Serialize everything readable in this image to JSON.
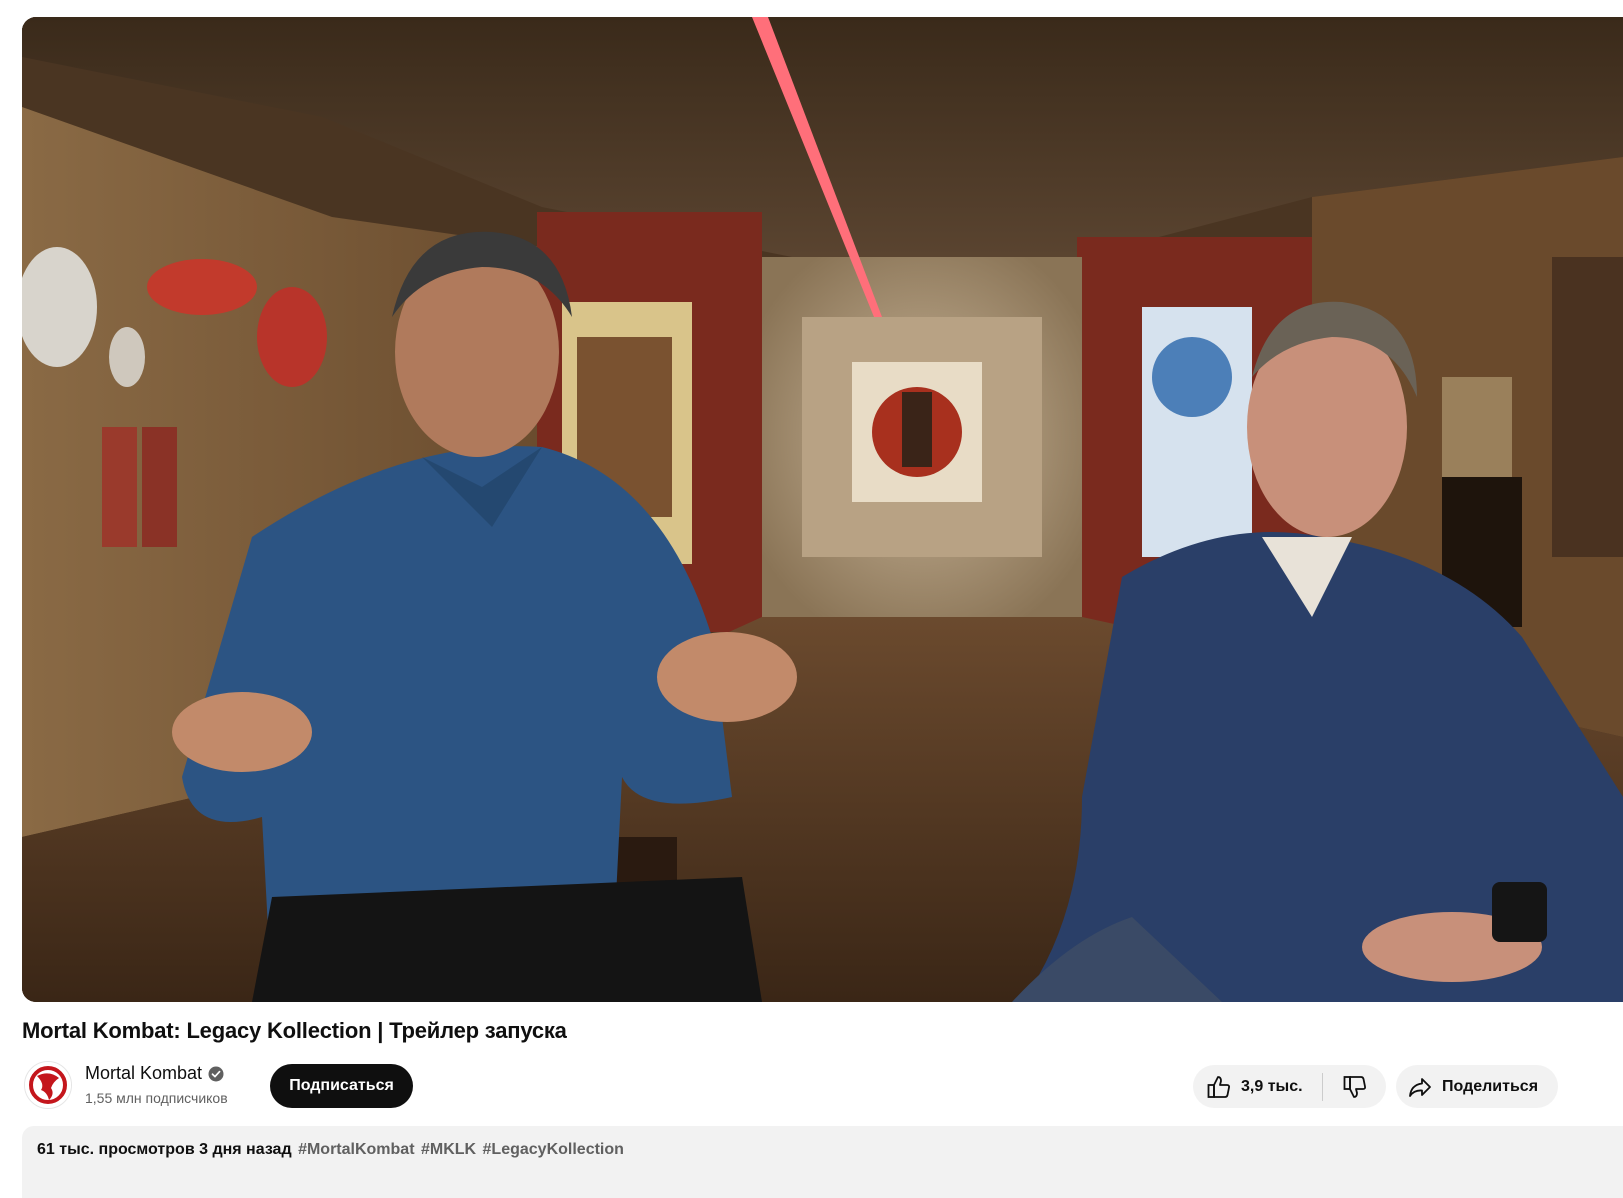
{
  "video": {
    "title": "Mortal Kombat: Legacy Kollection | Трейлер запуска",
    "frame_description_icon": "video-frame"
  },
  "channel": {
    "name": "Mortal Kombat",
    "subscribers": "1,55 млн подписчиков",
    "avatar_icon": "mortal-kombat-dragon-logo",
    "verified_icon": "verified-check-icon",
    "subscribe_label": "Подписаться"
  },
  "actions": {
    "like_count": "3,9 тыс.",
    "like_icon": "thumbs-up-icon",
    "dislike_icon": "thumbs-down-icon",
    "share_label": "Поделиться",
    "share_icon": "share-arrow-icon"
  },
  "description": {
    "views": "61 тыс. просмотров",
    "date": "3 дня назад",
    "hashtags": [
      "#MortalKombat",
      "#MKLK",
      "#LegacyKollection"
    ]
  },
  "colors": {
    "accent": "#0f0f0f",
    "chip_bg": "#f2f2f2",
    "brand_red": "#c4161c",
    "secondary_text": "#606060"
  }
}
